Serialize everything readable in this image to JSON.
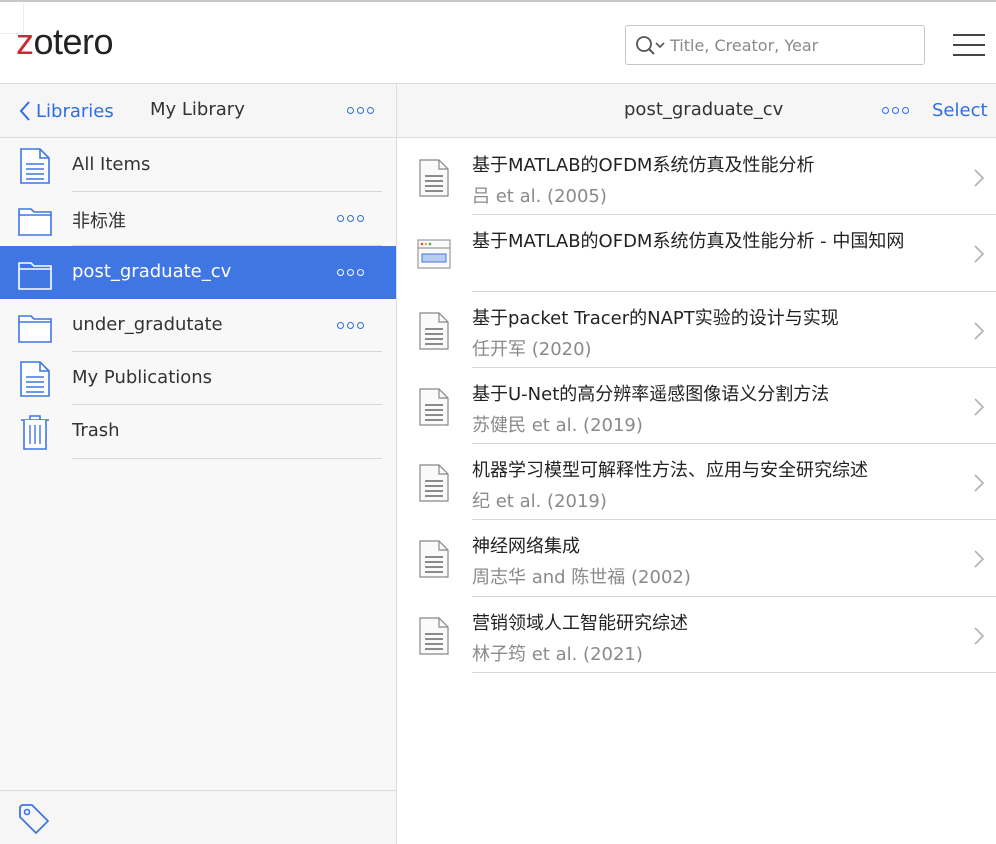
{
  "app": {
    "logo_prefix": "z",
    "logo_rest": "otero"
  },
  "search": {
    "placeholder": "Title, Creator, Year"
  },
  "left_pane": {
    "back_label": "Libraries",
    "title": "My Library",
    "collections": [
      {
        "label": "All Items",
        "icon": "document-icon",
        "has_menu": false,
        "active": false
      },
      {
        "label": "非标准",
        "icon": "folder-icon",
        "has_menu": true,
        "active": false
      },
      {
        "label": "post_graduate_cv",
        "icon": "folder-icon",
        "has_menu": true,
        "active": true
      },
      {
        "label": "under_gradutate",
        "icon": "folder-icon",
        "has_menu": true,
        "active": false
      },
      {
        "label": "My Publications",
        "icon": "document-icon",
        "has_menu": false,
        "active": false
      },
      {
        "label": "Trash",
        "icon": "trash-icon",
        "has_menu": false,
        "active": false
      }
    ]
  },
  "right_pane": {
    "title": "post_graduate_cv",
    "select_label": "Select",
    "items": [
      {
        "title": "基于MATLAB的OFDM系统仿真及性能分析",
        "creator": "吕 et al. (2005)",
        "icon": "document-icon"
      },
      {
        "title": "基于MATLAB的OFDM系统仿真及性能分析 - 中国知网",
        "creator": "",
        "icon": "webpage-icon"
      },
      {
        "title": "基于packet Tracer的NAPT实验的设计与实现",
        "creator": "任开军 (2020)",
        "icon": "document-icon"
      },
      {
        "title": "基于U-Net的高分辨率遥感图像语义分割方法",
        "creator": "苏健民 et al. (2019)",
        "icon": "document-icon"
      },
      {
        "title": "机器学习模型可解释性方法、应用与安全研究综述",
        "creator": "纪 et al. (2019)",
        "icon": "document-icon"
      },
      {
        "title": "神经网络集成",
        "creator": "周志华 and 陈世福 (2002)",
        "icon": "document-icon"
      },
      {
        "title": "营销领域人工智能研究综述",
        "creator": "林子筠 et al. (2021)",
        "icon": "document-icon"
      }
    ]
  },
  "colors": {
    "accent": "#2e6ee0",
    "active_row": "#3f76e4",
    "logo_red": "#cc2936"
  }
}
